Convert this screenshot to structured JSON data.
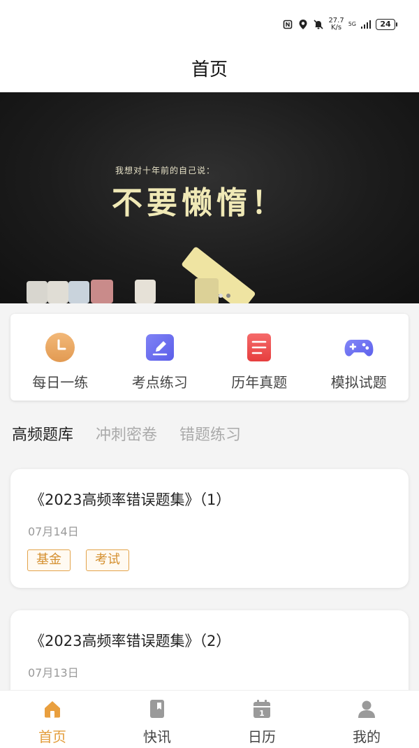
{
  "status_bar": {
    "speed_value": "27.7",
    "speed_unit": "K/s",
    "network": "5G",
    "battery": "24"
  },
  "header": {
    "title": "首页"
  },
  "banner": {
    "small_text": "我想对十年前的自己说：",
    "big_text": "不要懒惰！"
  },
  "quick_menu": [
    {
      "label": "每日一练",
      "icon": "clock-icon",
      "color": "#e9a35a"
    },
    {
      "label": "考点练习",
      "icon": "edit-icon",
      "color": "#6a6cf0"
    },
    {
      "label": "历年真题",
      "icon": "document-icon",
      "color": "#ee4b4b"
    },
    {
      "label": "模拟试题",
      "icon": "gamepad-icon",
      "color": "#6b6ff5"
    }
  ],
  "tabs": [
    "高频题库",
    "冲刺密卷",
    "错题练习"
  ],
  "articles": [
    {
      "title": "《2023高频率错误题集》（1）",
      "date": "07月14日",
      "tags": [
        "基金",
        "考试"
      ]
    },
    {
      "title": "《2023高频率错误题集》（2）",
      "date": "07月13日",
      "tags": []
    }
  ],
  "bottom_nav": [
    {
      "label": "首页",
      "icon": "home-icon"
    },
    {
      "label": "快讯",
      "icon": "bookmark-icon"
    },
    {
      "label": "日历",
      "icon": "calendar-icon"
    },
    {
      "label": "我的",
      "icon": "user-icon"
    }
  ],
  "colors": {
    "accent": "#e39d3c",
    "tag_border": "#e3a34b"
  }
}
